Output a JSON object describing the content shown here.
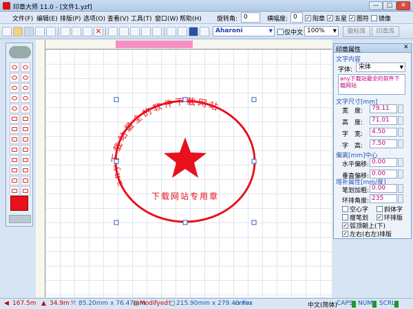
{
  "window": {
    "title": "印章大师 11.0 - [文件1.yzf]",
    "min": "—",
    "max": "□",
    "close": "✕",
    "close_bg": "#d94b3c"
  },
  "menu": [
    "文件(F)",
    "编辑(E)",
    "排版(P)",
    "选项(O)",
    "查看(V)",
    "工具(T)",
    "窗口(W)",
    "帮助(H)"
  ],
  "toolbar_right": {
    "rotation_label": "旋转角:",
    "rotation_value": "0",
    "hscale_label": "横幅度:",
    "hscale_value": "0",
    "yang_label": "阳章",
    "yang_checked": true,
    "star_label": "五星",
    "star_checked": true,
    "image_label": "图符",
    "image_checked": true,
    "mirror_label": "镜像",
    "mirror_checked": false,
    "font_value": "Aharoni",
    "cn_only_label": "仅中文",
    "cn_only_checked": false,
    "zoom_value": "100%",
    "stamp_lib_button": "徽标库",
    "seal_lib_button": "印章库"
  },
  "seal": {
    "top_text": "any下载站最全的软件下载网站",
    "bottom_text": "下载网站专用章",
    "color": "#e8111c"
  },
  "panel": {
    "title": "印章属性",
    "text_content_section": "文字内容",
    "font_label": "字体:",
    "font_value": "宋体",
    "text_value": "any下载站最全的软件下载网站",
    "size_section": "文字尺寸[mm]",
    "width_label": "宽　度:",
    "width_value": "79.11",
    "height_label": "高　度:",
    "height_value": "71.01",
    "char_width_label": "字　宽:",
    "char_width_value": "4.50",
    "char_height_label": "字　高:",
    "char_height_value": "7.50",
    "offset_section": "偏离[mm]中心",
    "hoffset_label": "水平偏移:",
    "hoffset_value": "0.00",
    "voffset_label": "垂直偏移:",
    "voffset_value": "0.00",
    "extra_section": "增补属性[mm/度]",
    "stroke_label": "笔划加粗:",
    "stroke_value": "0.00",
    "ring_angle_label": "环排角度:",
    "ring_angle_value": "235",
    "hollow_label": "空心字",
    "hollow_checked": false,
    "italic_label": "斜体字",
    "italic_checked": false,
    "thin_label": "瘦笔划",
    "thin_checked": false,
    "ring_label": "环排版",
    "ring_checked": true,
    "arc_label": "弧顶朝上(下)",
    "arc_checked": true,
    "lr_label": "左右(右左)排版",
    "lr_checked": true
  },
  "status": {
    "x": "167.5m",
    "y": "34.9m",
    "size": "85.20mm x 76.47mm",
    "modified": "Modifyed!",
    "page": "215.90mm x 279.40mm",
    "printer": "Fax",
    "ime": "中文(简体)",
    "caps": "CAPS",
    "num": "NUM",
    "scrl": "SCRL"
  }
}
